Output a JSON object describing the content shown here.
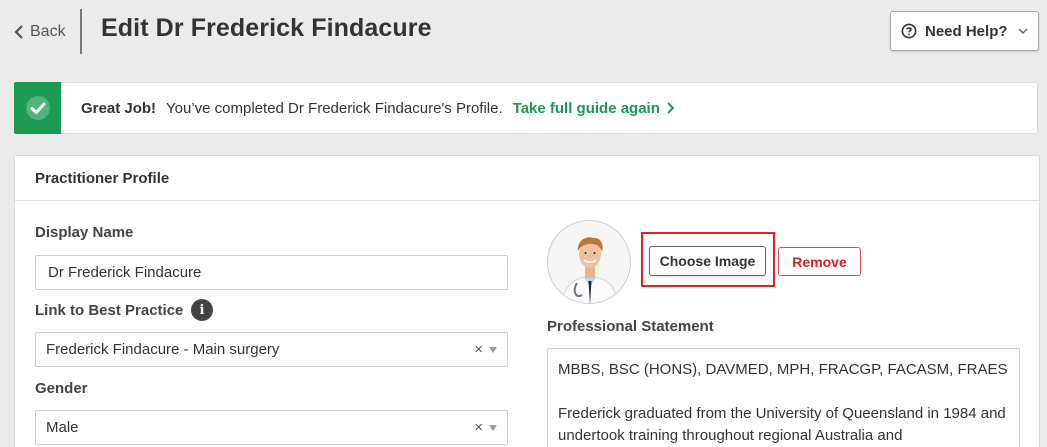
{
  "header": {
    "back_label": "Back",
    "title": "Edit Dr Frederick Findacure",
    "help_label": "Need Help?"
  },
  "banner": {
    "strong": "Great Job!",
    "text": "You’ve completed Dr Frederick Findacure's Profile.",
    "link": "Take full guide again"
  },
  "panel": {
    "title": "Practitioner Profile",
    "display_name": {
      "label": "Display Name",
      "value": "Dr Frederick Findacure"
    },
    "link_best_practice": {
      "label": "Link to Best Practice",
      "value": "Frederick Findacure - Main surgery"
    },
    "gender": {
      "label": "Gender",
      "value": "Male"
    },
    "image": {
      "choose_label": "Choose Image",
      "remove_label": "Remove"
    },
    "statement": {
      "label": "Professional Statement",
      "line1": "MBBS, BSC (HONS), DAVMED, MPH, FRACGP, FACASM, FRAES",
      "line2": "Frederick graduated from the University of Queensland in 1984 and undertook training throughout regional Australia and"
    }
  },
  "colors": {
    "accent_green": "#1a9a52",
    "remove_red": "#cc2222",
    "highlight_red": "#e02424"
  }
}
